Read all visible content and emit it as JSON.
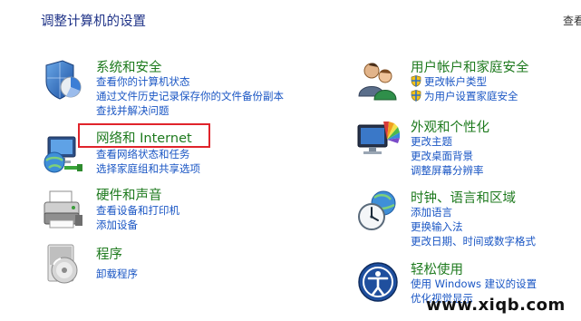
{
  "page_title": "调整计算机的设置",
  "view_by_label": "查看",
  "categories": [
    {
      "id": "system-security",
      "title": "系统和安全",
      "icon": "shield-icon",
      "links": [
        {
          "label": "查看你的计算机状态"
        },
        {
          "label": "通过文件历史记录保存你的文件备份副本"
        },
        {
          "label": "查找并解决问题"
        }
      ]
    },
    {
      "id": "network-internet",
      "title": "网络和 Internet",
      "icon": "network-globe-icon",
      "links": [
        {
          "label": "查看网络状态和任务"
        },
        {
          "label": "选择家庭组和共享选项"
        }
      ]
    },
    {
      "id": "hardware-sound",
      "title": "硬件和声音",
      "icon": "printer-icon",
      "links": [
        {
          "label": "查看设备和打印机"
        },
        {
          "label": "添加设备"
        }
      ]
    },
    {
      "id": "programs",
      "title": "程序",
      "icon": "programs-disc-icon",
      "links": [
        {
          "label": "卸载程序"
        }
      ]
    },
    {
      "id": "user-accounts",
      "title": "用户帐户和家庭安全",
      "icon": "users-icon",
      "links": [
        {
          "label": "更改帐户类型",
          "shield": true
        },
        {
          "label": "为用户设置家庭安全",
          "shield": true
        }
      ]
    },
    {
      "id": "appearance",
      "title": "外观和个性化",
      "icon": "monitor-palette-icon",
      "links": [
        {
          "label": "更改主题"
        },
        {
          "label": "更改桌面背景"
        },
        {
          "label": "调整屏幕分辨率"
        }
      ]
    },
    {
      "id": "clock-language-region",
      "title": "时钟、语言和区域",
      "icon": "clock-globe-icon",
      "links": [
        {
          "label": "添加语言"
        },
        {
          "label": "更换输入法"
        },
        {
          "label": "更改日期、时间或数字格式"
        }
      ]
    },
    {
      "id": "ease-of-access",
      "title": "轻松使用",
      "icon": "ease-of-access-icon",
      "links": [
        {
          "label": "使用 Windows 建议的设置"
        },
        {
          "label": "优化视觉显示"
        }
      ]
    }
  ],
  "watermark": "www.xiqb.com",
  "colors": {
    "title_blue": "#1e3287",
    "category_green": "#1e7a1e",
    "link_blue": "#1a56c4",
    "highlight_red": "#e0242b"
  }
}
